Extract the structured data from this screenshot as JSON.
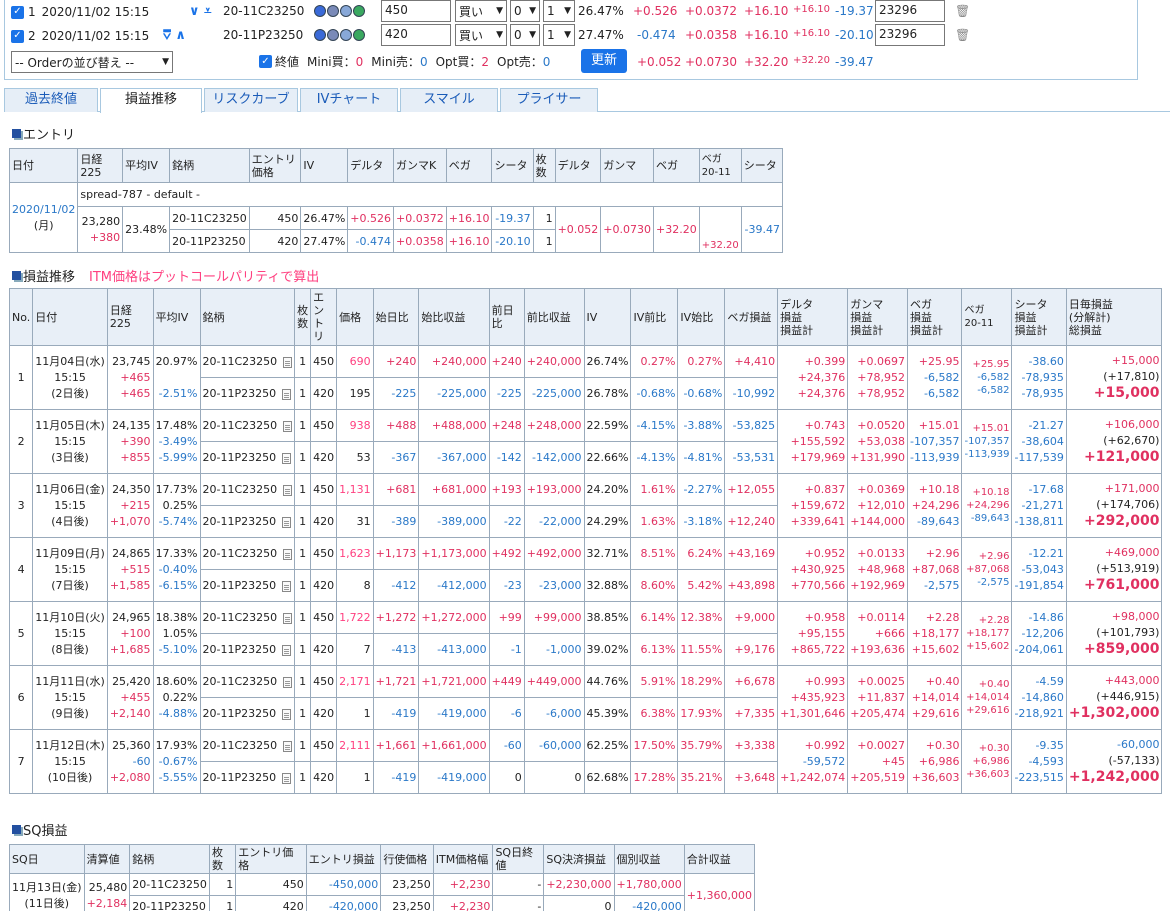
{
  "top": {
    "rows": [
      {
        "idx": "1",
        "datetime": "2020/11/02 15:15",
        "arrows": "⮟⮟",
        "code": "20-11C23250",
        "price": "450",
        "side": "買い",
        "n0": "0",
        "n1": "1",
        "iv": "26.47%",
        "delta": "+0.526",
        "gamma": "+0.0372",
        "vega": "+16.10",
        "vega2": "+16.10",
        "theta": "-19.37",
        "strike": "23296"
      },
      {
        "idx": "2",
        "datetime": "2020/11/02 15:15",
        "arrows": "⮝⮝",
        "code": "20-11P23250",
        "price": "420",
        "side": "買い",
        "n0": "0",
        "n1": "1",
        "iv": "27.47%",
        "delta": "-0.474",
        "gamma": "+0.0358",
        "vega": "+16.10",
        "vega2": "+16.10",
        "theta": "-20.10",
        "strike": "23296"
      }
    ],
    "order_select": "-- Orderの並び替え --",
    "close_label": "終値",
    "mini_buy_label": "Mini買：",
    "mini_buy": "0",
    "mini_sell_label": "Mini売：",
    "mini_sell": "0",
    "opt_buy_label": "Opt買：",
    "opt_buy": "2",
    "opt_sell_label": "Opt売：",
    "opt_sell": "0",
    "update_button": "更新",
    "sum": {
      "delta": "+0.052",
      "gamma": "+0.0730",
      "vega": "+32.20",
      "vega2": "+32.20",
      "theta": "-39.47"
    }
  },
  "tabs": [
    "過去終値",
    "損益推移",
    "リスクカーブ",
    "IVチャート",
    "スマイル",
    "プライサー"
  ],
  "entry": {
    "title": "エントリ",
    "headers": [
      "日付",
      "日経225",
      "平均IV",
      "銘柄",
      "エントリ価格",
      "IV",
      "デルタ",
      "ガンマK",
      "ベガ",
      "シータ",
      "枚数",
      "デルタ",
      "ガンマ",
      "ベガ",
      "ベガ\n20-11",
      "シータ"
    ],
    "spread_label": "spread-787 - default -",
    "date": "2020/11/02",
    "weekday": "(月)",
    "nikkei": "23,280",
    "nikkei_diff": "+380",
    "avg_iv": "23.48%",
    "legs": [
      {
        "code": "20-11C23250",
        "price": "450",
        "iv": "26.47%",
        "delta": "+0.526",
        "gamma": "+0.0372",
        "vega": "+16.10",
        "theta": "-19.37",
        "qty": "1"
      },
      {
        "code": "20-11P23250",
        "price": "420",
        "iv": "27.47%",
        "delta": "-0.474",
        "gamma": "+0.0358",
        "vega": "+16.10",
        "theta": "-20.10",
        "qty": "1"
      }
    ],
    "sum": {
      "delta": "+0.052",
      "gamma": "+0.0730",
      "vega": "+32.20",
      "vega2": "+32.20",
      "theta": "-39.47"
    }
  },
  "pnl": {
    "title": "損益推移",
    "note": "ITM価格はプットコールパリティで算出",
    "headers": [
      "No.",
      "日付",
      "日経225",
      "平均IV",
      "銘柄",
      "枚数",
      "エントリ",
      "価格",
      "始日比",
      "始比収益",
      "前日比",
      "前比収益",
      "IV",
      "IV前比",
      "IV始比",
      "ベガ損益",
      "デルタ\n損益\n損益計",
      "ガンマ\n損益\n損益計",
      "ベガ\n損益\n損益計",
      "ベガ\n20-11",
      "シータ\n損益\n損益計",
      "日毎損益\n(分解計)\n総損益"
    ],
    "rows": [
      {
        "no": "1",
        "date": "11月04日(水)",
        "time": "15:15",
        "days": "(2日後)",
        "nk": "23,745",
        "nk_d1": "+465",
        "nk_d2": "+465",
        "aiv": "20.97%",
        "aiv_d1": "",
        "aiv_d2": "-2.51%",
        "legs": [
          {
            "code": "20-11C23250",
            "qty": "1",
            "entry": "450",
            "price": "690",
            "sd": "+240",
            "sp": "+240,000",
            "pd": "+240",
            "pp": "+240,000",
            "iv": "26.74%",
            "ivp": "0.27%",
            "ivs": "0.27%",
            "vp": "+4,410"
          },
          {
            "code": "20-11P23250",
            "qty": "1",
            "entry": "420",
            "price": "195",
            "sd": "-225",
            "sp": "-225,000",
            "pd": "-225",
            "pp": "-225,000",
            "iv": "26.78%",
            "ivp": "-0.68%",
            "ivs": "-0.68%",
            "vp": "-10,992"
          }
        ],
        "dl": [
          "+0.399",
          "+24,376",
          "+24,376"
        ],
        "gm": [
          "+0.0697",
          "+78,952",
          "+78,952"
        ],
        "vg": [
          "+25.95",
          "-6,582",
          "-6,582"
        ],
        "v2": [
          "+25.95",
          "-6,582",
          "-6,582"
        ],
        "th": [
          "-38.60",
          "-78,935",
          "-78,935"
        ],
        "dy": [
          "+15,000",
          "(+17,810)",
          "+15,000"
        ]
      },
      {
        "no": "2",
        "date": "11月05日(木)",
        "time": "15:15",
        "days": "(3日後)",
        "nk": "24,135",
        "nk_d1": "+390",
        "nk_d2": "+855",
        "aiv": "17.48%",
        "aiv_d1": "-3.49%",
        "aiv_d2": "-5.99%",
        "legs": [
          {
            "code": "20-11C23250",
            "qty": "1",
            "entry": "450",
            "price": "938",
            "sd": "+488",
            "sp": "+488,000",
            "pd": "+248",
            "pp": "+248,000",
            "iv": "22.59%",
            "ivp": "-4.15%",
            "ivs": "-3.88%",
            "vp": "-53,825"
          },
          {
            "code": "20-11P23250",
            "qty": "1",
            "entry": "420",
            "price": "53",
            "sd": "-367",
            "sp": "-367,000",
            "pd": "-142",
            "pp": "-142,000",
            "iv": "22.66%",
            "ivp": "-4.13%",
            "ivs": "-4.81%",
            "vp": "-53,531"
          }
        ],
        "dl": [
          "+0.743",
          "+155,592",
          "+179,969"
        ],
        "gm": [
          "+0.0520",
          "+53,038",
          "+131,990"
        ],
        "vg": [
          "+15.01",
          "-107,357",
          "-113,939"
        ],
        "v2": [
          "+15.01",
          "-107,357",
          "-113,939"
        ],
        "th": [
          "-21.27",
          "-38,604",
          "-117,539"
        ],
        "dy": [
          "+106,000",
          "(+62,670)",
          "+121,000"
        ]
      },
      {
        "no": "3",
        "date": "11月06日(金)",
        "time": "15:15",
        "days": "(4日後)",
        "nk": "24,350",
        "nk_d1": "+215",
        "nk_d2": "+1,070",
        "aiv": "17.73%",
        "aiv_d1": "0.25%",
        "aiv_d2": "-5.74%",
        "legs": [
          {
            "code": "20-11C23250",
            "qty": "1",
            "entry": "450",
            "price": "1,131",
            "sd": "+681",
            "sp": "+681,000",
            "pd": "+193",
            "pp": "+193,000",
            "iv": "24.20%",
            "ivp": "1.61%",
            "ivs": "-2.27%",
            "vp": "+12,055"
          },
          {
            "code": "20-11P23250",
            "qty": "1",
            "entry": "420",
            "price": "31",
            "sd": "-389",
            "sp": "-389,000",
            "pd": "-22",
            "pp": "-22,000",
            "iv": "24.29%",
            "ivp": "1.63%",
            "ivs": "-3.18%",
            "vp": "+12,240"
          }
        ],
        "dl": [
          "+0.837",
          "+159,672",
          "+339,641"
        ],
        "gm": [
          "+0.0369",
          "+12,010",
          "+144,000"
        ],
        "vg": [
          "+10.18",
          "+24,296",
          "-89,643"
        ],
        "v2": [
          "+10.18",
          "+24,296",
          "-89,643"
        ],
        "th": [
          "-17.68",
          "-21,271",
          "-138,811"
        ],
        "dy": [
          "+171,000",
          "(+174,706)",
          "+292,000"
        ]
      },
      {
        "no": "4",
        "date": "11月09日(月)",
        "time": "15:15",
        "days": "(7日後)",
        "nk": "24,865",
        "nk_d1": "+515",
        "nk_d2": "+1,585",
        "aiv": "17.33%",
        "aiv_d1": "-0.40%",
        "aiv_d2": "-6.15%",
        "legs": [
          {
            "code": "20-11C23250",
            "qty": "1",
            "entry": "450",
            "price": "1,623",
            "sd": "+1,173",
            "sp": "+1,173,000",
            "pd": "+492",
            "pp": "+492,000",
            "iv": "32.71%",
            "ivp": "8.51%",
            "ivs": "6.24%",
            "vp": "+43,169"
          },
          {
            "code": "20-11P23250",
            "qty": "1",
            "entry": "420",
            "price": "8",
            "sd": "-412",
            "sp": "-412,000",
            "pd": "-23",
            "pp": "-23,000",
            "iv": "32.88%",
            "ivp": "8.60%",
            "ivs": "5.42%",
            "vp": "+43,898"
          }
        ],
        "dl": [
          "+0.952",
          "+430,925",
          "+770,566"
        ],
        "gm": [
          "+0.0133",
          "+48,968",
          "+192,969"
        ],
        "vg": [
          "+2.96",
          "+87,068",
          "-2,575"
        ],
        "v2": [
          "+2.96",
          "+87,068",
          "-2,575"
        ],
        "th": [
          "-12.21",
          "-53,043",
          "-191,854"
        ],
        "dy": [
          "+469,000",
          "(+513,919)",
          "+761,000"
        ]
      },
      {
        "no": "5",
        "date": "11月10日(火)",
        "time": "15:15",
        "days": "(8日後)",
        "nk": "24,965",
        "nk_d1": "+100",
        "nk_d2": "+1,685",
        "aiv": "18.38%",
        "aiv_d1": "1.05%",
        "aiv_d2": "-5.10%",
        "legs": [
          {
            "code": "20-11C23250",
            "qty": "1",
            "entry": "450",
            "price": "1,722",
            "sd": "+1,272",
            "sp": "+1,272,000",
            "pd": "+99",
            "pp": "+99,000",
            "iv": "38.85%",
            "ivp": "6.14%",
            "ivs": "12.38%",
            "vp": "+9,000"
          },
          {
            "code": "20-11P23250",
            "qty": "1",
            "entry": "420",
            "price": "7",
            "sd": "-413",
            "sp": "-413,000",
            "pd": "-1",
            "pp": "-1,000",
            "iv": "39.02%",
            "ivp": "6.13%",
            "ivs": "11.55%",
            "vp": "+9,176"
          }
        ],
        "dl": [
          "+0.958",
          "+95,155",
          "+865,722"
        ],
        "gm": [
          "+0.0114",
          "+666",
          "+193,636"
        ],
        "vg": [
          "+2.28",
          "+18,177",
          "+15,602"
        ],
        "v2": [
          "+2.28",
          "+18,177",
          "+15,602"
        ],
        "th": [
          "-14.86",
          "-12,206",
          "-204,061"
        ],
        "dy": [
          "+98,000",
          "(+101,793)",
          "+859,000"
        ]
      },
      {
        "no": "6",
        "date": "11月11日(水)",
        "time": "15:15",
        "days": "(9日後)",
        "nk": "25,420",
        "nk_d1": "+455",
        "nk_d2": "+2,140",
        "aiv": "18.60%",
        "aiv_d1": "0.22%",
        "aiv_d2": "-4.88%",
        "legs": [
          {
            "code": "20-11C23250",
            "qty": "1",
            "entry": "450",
            "price": "2,171",
            "sd": "+1,721",
            "sp": "+1,721,000",
            "pd": "+449",
            "pp": "+449,000",
            "iv": "44.76%",
            "ivp": "5.91%",
            "ivs": "18.29%",
            "vp": "+6,678"
          },
          {
            "code": "20-11P23250",
            "qty": "1",
            "entry": "420",
            "price": "1",
            "sd": "-419",
            "sp": "-419,000",
            "pd": "-6",
            "pp": "-6,000",
            "iv": "45.39%",
            "ivp": "6.38%",
            "ivs": "17.93%",
            "vp": "+7,335"
          }
        ],
        "dl": [
          "+0.993",
          "+435,923",
          "+1,301,646"
        ],
        "gm": [
          "+0.0025",
          "+11,837",
          "+205,474"
        ],
        "vg": [
          "+0.40",
          "+14,014",
          "+29,616"
        ],
        "v2": [
          "+0.40",
          "+14,014",
          "+29,616"
        ],
        "th": [
          "-4.59",
          "-14,860",
          "-218,921"
        ],
        "dy": [
          "+443,000",
          "(+446,915)",
          "+1,302,000"
        ]
      },
      {
        "no": "7",
        "date": "11月12日(木)",
        "time": "15:15",
        "days": "(10日後)",
        "nk": "25,360",
        "nk_d1": "-60",
        "nk_d2": "+2,080",
        "aiv": "17.93%",
        "aiv_d1": "-0.67%",
        "aiv_d2": "-5.55%",
        "legs": [
          {
            "code": "20-11C23250",
            "qty": "1",
            "entry": "450",
            "price": "2,111",
            "sd": "+1,661",
            "sp": "+1,661,000",
            "pd": "-60",
            "pp": "-60,000",
            "iv": "62.25%",
            "ivp": "17.50%",
            "ivs": "35.79%",
            "vp": "+3,338"
          },
          {
            "code": "20-11P23250",
            "qty": "1",
            "entry": "420",
            "price": "1",
            "sd": "-419",
            "sp": "-419,000",
            "pd": "0",
            "pp": "0",
            "iv": "62.68%",
            "ivp": "17.28%",
            "ivs": "35.21%",
            "vp": "+3,648"
          }
        ],
        "dl": [
          "+0.992",
          "-59,572",
          "+1,242,074"
        ],
        "gm": [
          "+0.0027",
          "+45",
          "+205,519"
        ],
        "vg": [
          "+0.30",
          "+6,986",
          "+36,603"
        ],
        "v2": [
          "+0.30",
          "+6,986",
          "+36,603"
        ],
        "th": [
          "-9.35",
          "-4,593",
          "-223,515"
        ],
        "dy": [
          "-60,000",
          "(-57,133)",
          "+1,242,000"
        ]
      }
    ]
  },
  "sq": {
    "title": "SQ損益",
    "headers": [
      "SQ日",
      "清算値",
      "銘柄",
      "枚数",
      "エントリ価格",
      "エントリ損益",
      "行使価格",
      "ITM価格幅",
      "SQ日終値",
      "SQ決済損益",
      "個別収益",
      "合計収益"
    ],
    "date": "11月13日(金)",
    "days": "(11日後)",
    "settle": "25,480",
    "settle_diff": "+2,184",
    "total": "+1,360,000",
    "legs": [
      {
        "code": "20-11C23250",
        "qty": "1",
        "entry": "450",
        "entry_pl": "-450,000",
        "strike": "23,250",
        "itm": "+2,230",
        "close": "-",
        "sq_pl": "+2,230,000",
        "ind": "+1,780,000"
      },
      {
        "code": "20-11P23250",
        "qty": "1",
        "entry": "420",
        "entry_pl": "-420,000",
        "strike": "23,250",
        "itm": "+2,230",
        "close": "-",
        "sq_pl": "0",
        "ind": "-420,000"
      }
    ]
  }
}
